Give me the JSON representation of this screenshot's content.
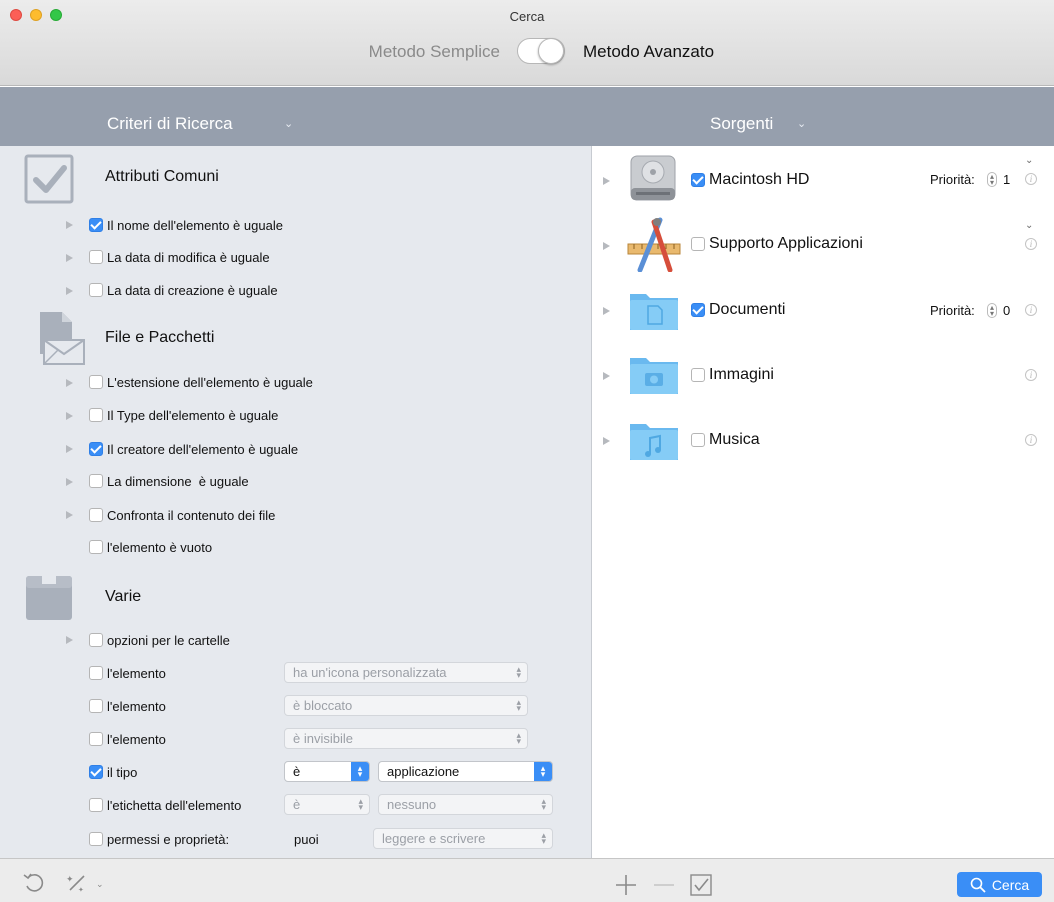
{
  "window": {
    "title": "Cerca"
  },
  "mode": {
    "simple_label": "Metodo Semplice",
    "advanced_label": "Metodo Avanzato",
    "advanced_on": true
  },
  "left_header": {
    "title": "Criteri di Ricerca",
    "chevron": "⌄"
  },
  "right_header": {
    "title": "Sorgenti",
    "chevron": "⌄"
  },
  "sections": {
    "common": {
      "title": "Attributi Comuni",
      "icon": "checkbox-icon"
    },
    "files": {
      "title": "File e Pacchetti",
      "icon": "document-envelope-icon"
    },
    "misc": {
      "title": "Varie",
      "icon": "box-icon"
    }
  },
  "criteria": {
    "name_equal": {
      "label": "Il nome dell'elemento è uguale",
      "checked": true
    },
    "mod_date_equal": {
      "label": "La data di modifica è uguale",
      "checked": false
    },
    "creation_date_equal": {
      "label": "La data di creazione è uguale",
      "checked": false
    },
    "extension_equal": {
      "label": "L'estensione dell'elemento è uguale",
      "checked": false
    },
    "type_equal": {
      "label": "Il Type dell'elemento è uguale",
      "checked": false
    },
    "creator_equal": {
      "label": "Il creatore dell'elemento è uguale",
      "checked": true
    },
    "size_equal": {
      "label": "La dimensione  è uguale",
      "checked": false
    },
    "compare_content": {
      "label": "Confronta il contenuto dei file",
      "checked": false
    },
    "empty": {
      "label": "l'elemento è vuoto",
      "checked": false
    },
    "folder_options": {
      "label": "opzioni per le cartelle",
      "checked": false
    },
    "custom_icon": {
      "label": "l'elemento",
      "value": "ha un'icona personalizzata",
      "checked": false
    },
    "locked": {
      "label": "l'elemento",
      "value": "è bloccato",
      "checked": false
    },
    "invisible": {
      "label": "l'elemento",
      "value": "è invisibile",
      "checked": false
    },
    "kind": {
      "label": "il tipo",
      "op": "è",
      "value": "applicazione",
      "checked": true
    },
    "item_label": {
      "label": "l'etichetta dell'elemento",
      "op": "è",
      "value": "nessuno",
      "checked": false
    },
    "permissions": {
      "label": "permessi e proprietà:",
      "who": "puoi",
      "value": "leggere e scrivere",
      "checked": false
    }
  },
  "sources": [
    {
      "name": "Macintosh HD",
      "checked": true,
      "priority_label": "Priorità:",
      "priority": "1",
      "icon": "hard-drive-icon"
    },
    {
      "name": "Supporto Applicazioni",
      "checked": false,
      "icon": "applications-icon"
    },
    {
      "name": "Documenti",
      "checked": true,
      "priority_label": "Priorità:",
      "priority": "0",
      "icon": "documents-folder-icon"
    },
    {
      "name": "Immagini",
      "checked": false,
      "icon": "pictures-folder-icon"
    },
    {
      "name": "Musica",
      "checked": false,
      "icon": "music-folder-icon"
    }
  ],
  "bottom": {
    "search_label": "Cerca"
  },
  "colors": {
    "accent": "#3a8ef6",
    "band": "#969fad",
    "left_pane": "#e6e9ee",
    "folder": "#7cc7f4"
  }
}
